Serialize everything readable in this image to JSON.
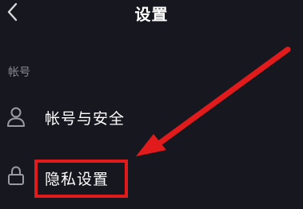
{
  "header": {
    "title": "设置",
    "back_icon": "chevron-left-icon"
  },
  "section": {
    "label": "帐号"
  },
  "rows": {
    "account_security": {
      "label": "帐号与安全",
      "icon": "user-icon"
    },
    "privacy": {
      "label": "隐私设置",
      "icon": "lock-icon"
    }
  },
  "annotation": {
    "color": "#e11b1b"
  },
  "colors": {
    "background": "#17171f",
    "text": "#ffffff",
    "muted": "#8a8a92"
  }
}
